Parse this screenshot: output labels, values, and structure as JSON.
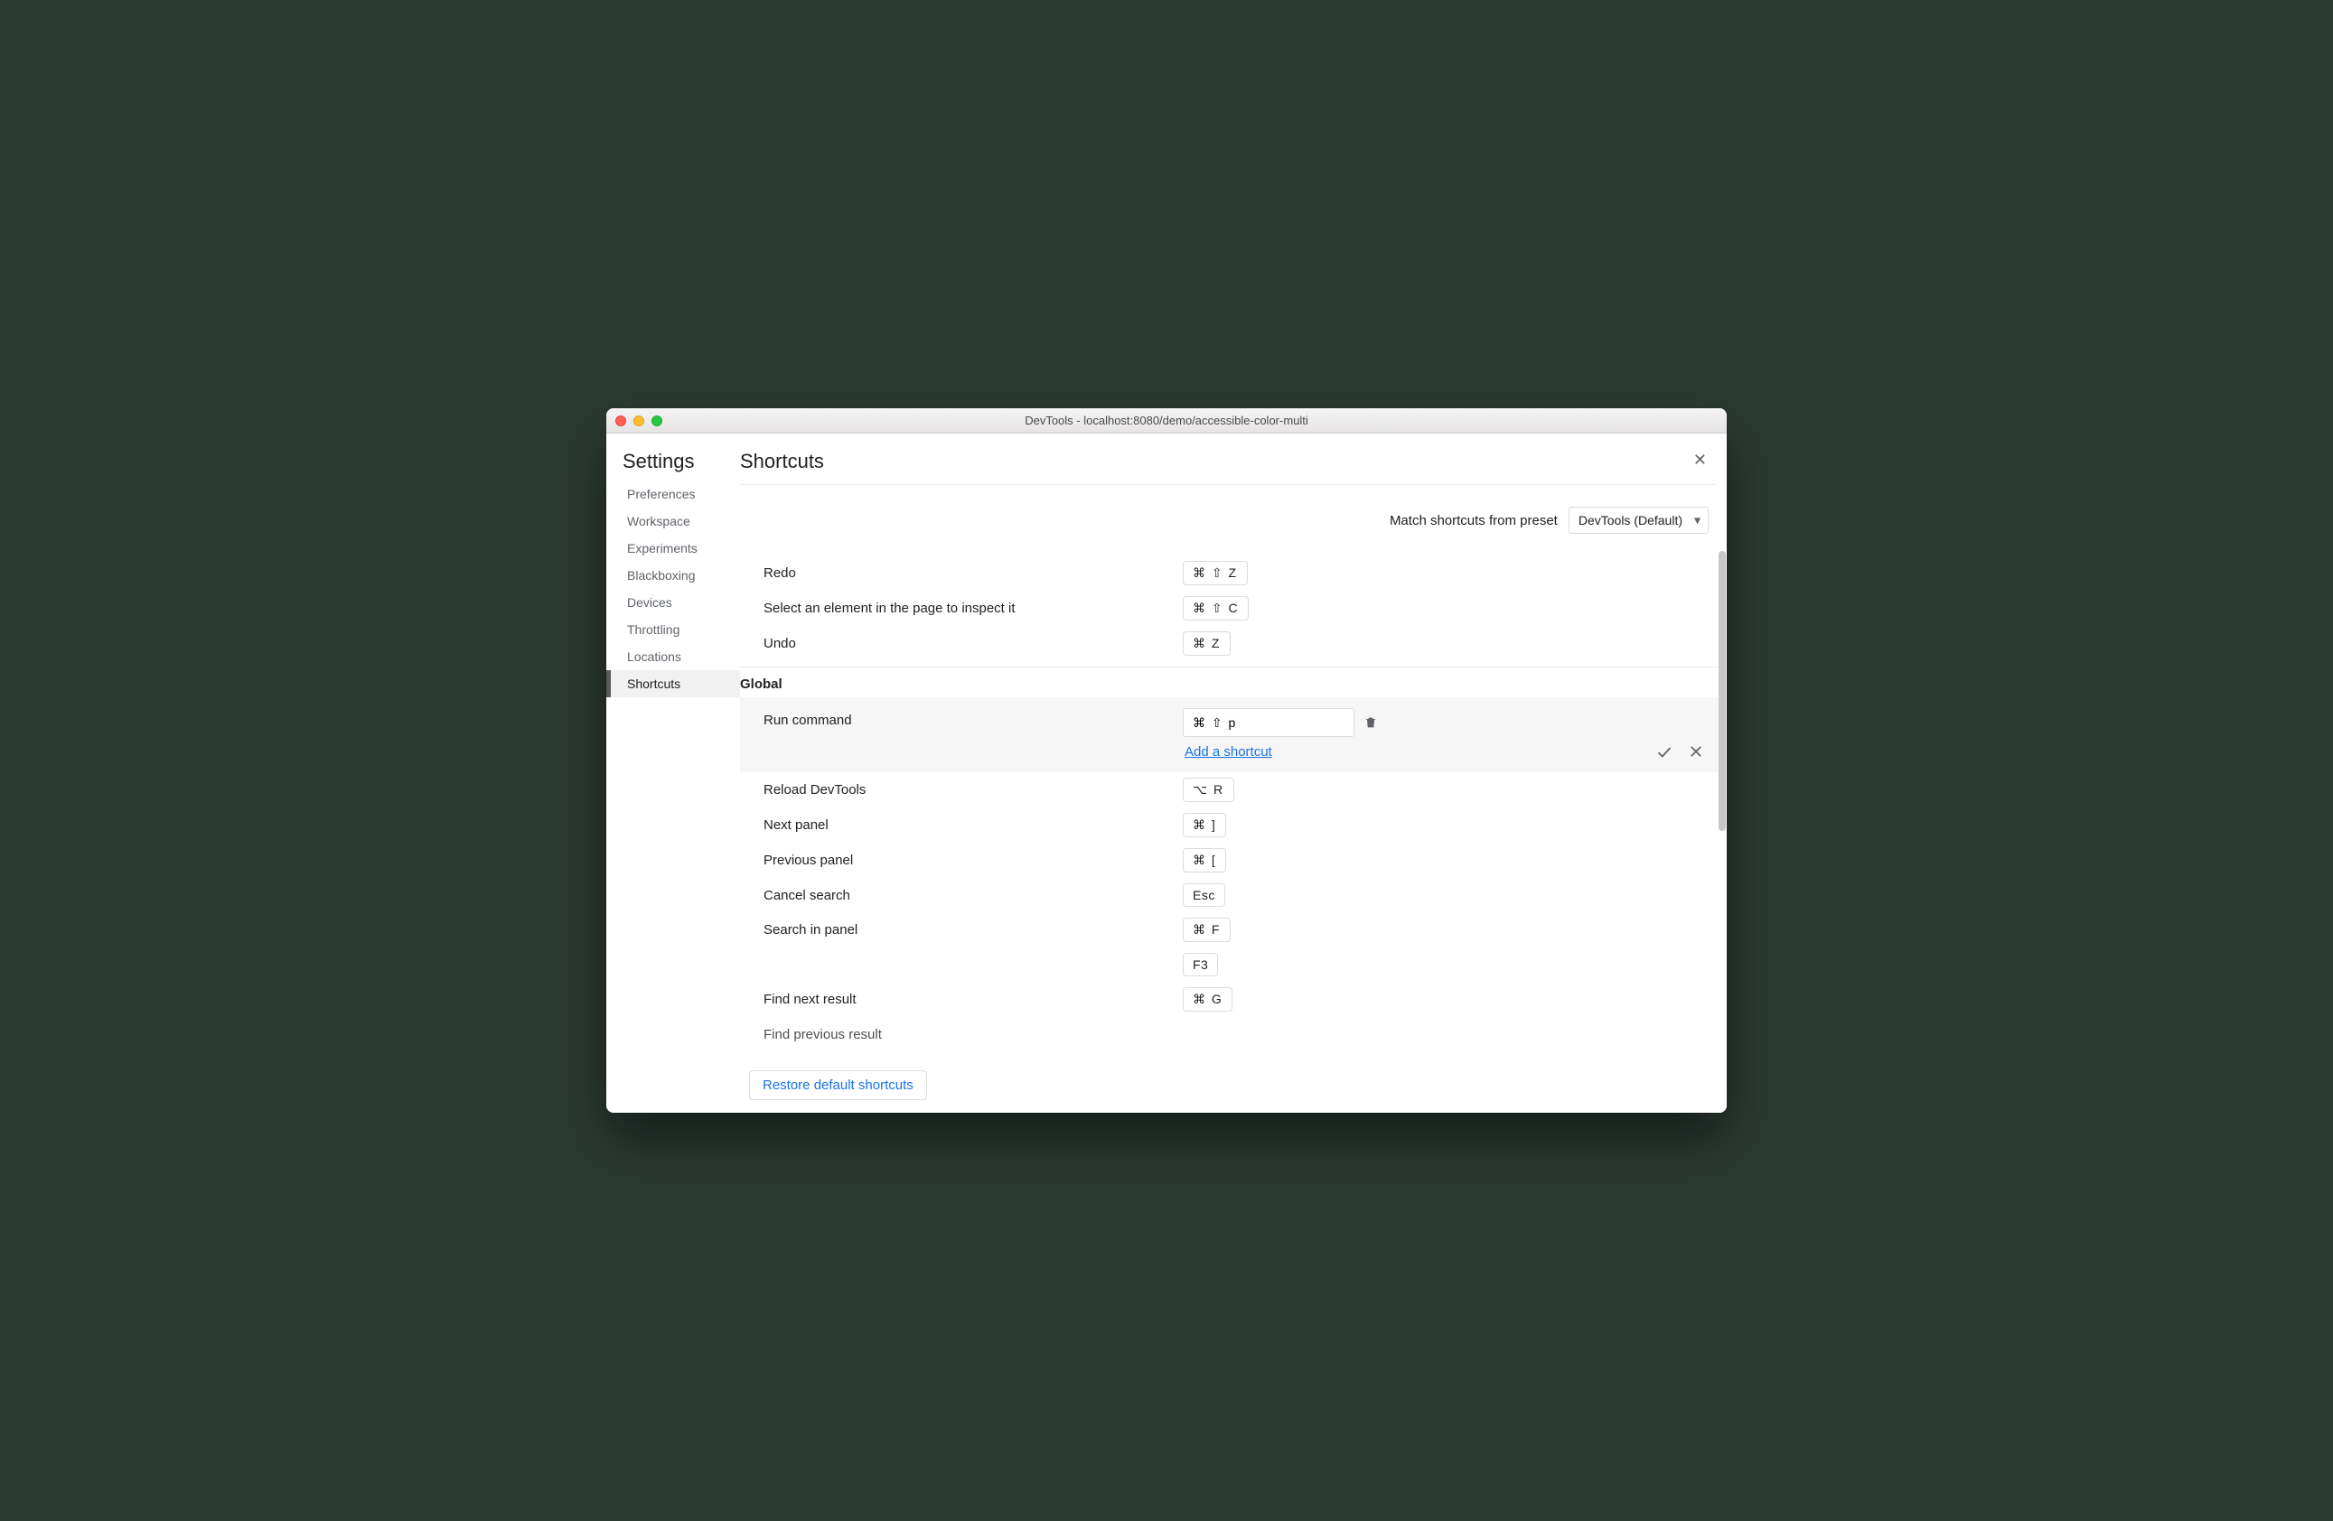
{
  "window": {
    "title": "DevTools - localhost:8080/demo/accessible-color-multi"
  },
  "sidebar": {
    "title": "Settings",
    "items": [
      {
        "label": "Preferences",
        "active": false
      },
      {
        "label": "Workspace",
        "active": false
      },
      {
        "label": "Experiments",
        "active": false
      },
      {
        "label": "Blackboxing",
        "active": false
      },
      {
        "label": "Devices",
        "active": false
      },
      {
        "label": "Throttling",
        "active": false
      },
      {
        "label": "Locations",
        "active": false
      },
      {
        "label": "Shortcuts",
        "active": true
      }
    ]
  },
  "page": {
    "title": "Shortcuts"
  },
  "preset": {
    "label": "Match shortcuts from preset",
    "value": "DevTools (Default)"
  },
  "top_rows": [
    {
      "label": "Redo",
      "keys": "⌘ ⇧ Z"
    },
    {
      "label": "Select an element in the page to inspect it",
      "keys": "⌘ ⇧ C"
    },
    {
      "label": "Undo",
      "keys": "⌘ Z"
    }
  ],
  "section_head": "Global",
  "editing": {
    "label": "Run command",
    "input_value": "⌘ ⇧ p",
    "add_link": "Add a shortcut"
  },
  "rows_after": [
    {
      "label": "Reload DevTools",
      "keys": [
        "⌥ R"
      ]
    },
    {
      "label": "Next panel",
      "keys": [
        "⌘ ]"
      ]
    },
    {
      "label": "Previous panel",
      "keys": [
        "⌘ ["
      ]
    },
    {
      "label": "Cancel search",
      "keys": [
        "Esc"
      ]
    },
    {
      "label": "Search in panel",
      "keys": [
        "⌘ F",
        "F3"
      ]
    },
    {
      "label": "Find next result",
      "keys": [
        "⌘ G"
      ]
    },
    {
      "label": "Find previous result",
      "keys": []
    }
  ],
  "restore_label": "Restore default shortcuts"
}
